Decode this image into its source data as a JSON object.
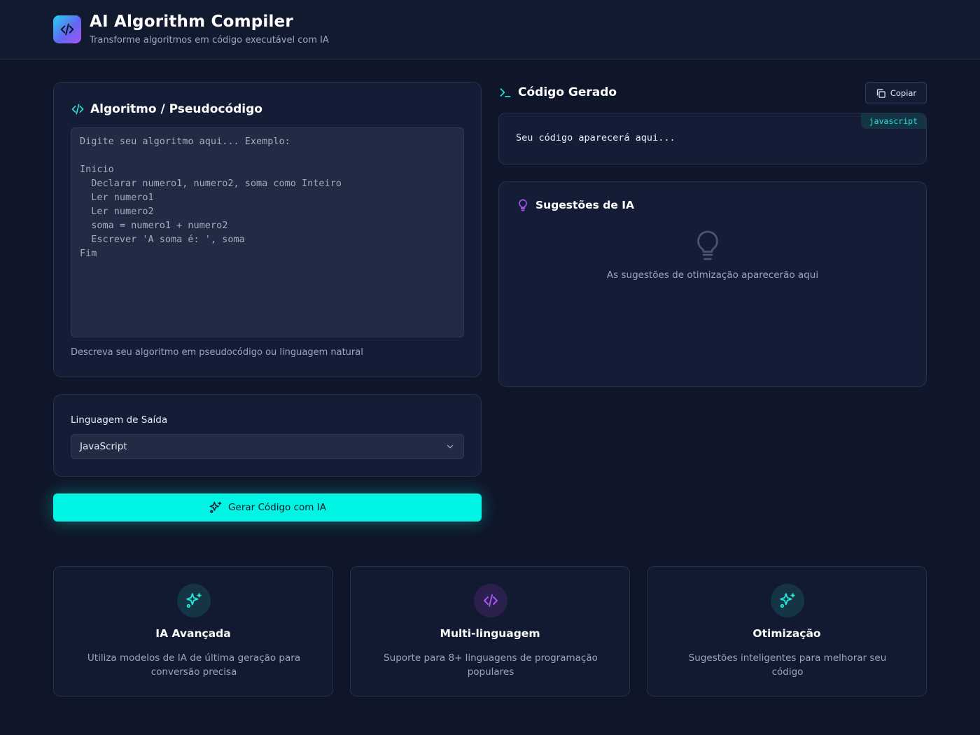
{
  "header": {
    "title": "AI Algorithm Compiler",
    "subtitle": "Transforme algoritmos em código executável com IA"
  },
  "input_panel": {
    "title": "Algoritmo / Pseudocódigo",
    "placeholder": "Digite seu algoritmo aqui... Exemplo:\n\nInicio\n  Declarar numero1, numero2, soma como Inteiro\n  Ler numero1\n  Ler numero2\n  soma = numero1 + numero2\n  Escrever 'A soma é: ', soma\nFim",
    "hint": "Descreva seu algoritmo em pseudocódigo ou linguagem natural"
  },
  "language_panel": {
    "label": "Linguagem de Saída",
    "selected": "JavaScript"
  },
  "generate_button": {
    "label": "Gerar Código com IA"
  },
  "output_panel": {
    "title": "Código Gerado",
    "copy_label": "Copiar",
    "language_badge": "javascript",
    "placeholder": "Seu código aparecerá aqui..."
  },
  "suggestions_panel": {
    "title": "Sugestões de IA",
    "empty_text": "As sugestões de otimização aparecerão aqui"
  },
  "features": [
    {
      "title": "IA Avançada",
      "description": "Utiliza modelos de IA de última geração para conversão precisa",
      "icon": "sparkles-icon"
    },
    {
      "title": "Multi-linguagem",
      "description": "Suporte para 8+ linguagens de programação populares",
      "icon": "code-icon"
    },
    {
      "title": "Otimização",
      "description": "Sugestões inteligentes para melhorar seu código",
      "icon": "sparkles-icon"
    }
  ],
  "colors": {
    "background": "#0f1629",
    "card": "#141d35",
    "accent_cyan": "#00f5e4",
    "accent_purple": "#a855f7"
  }
}
